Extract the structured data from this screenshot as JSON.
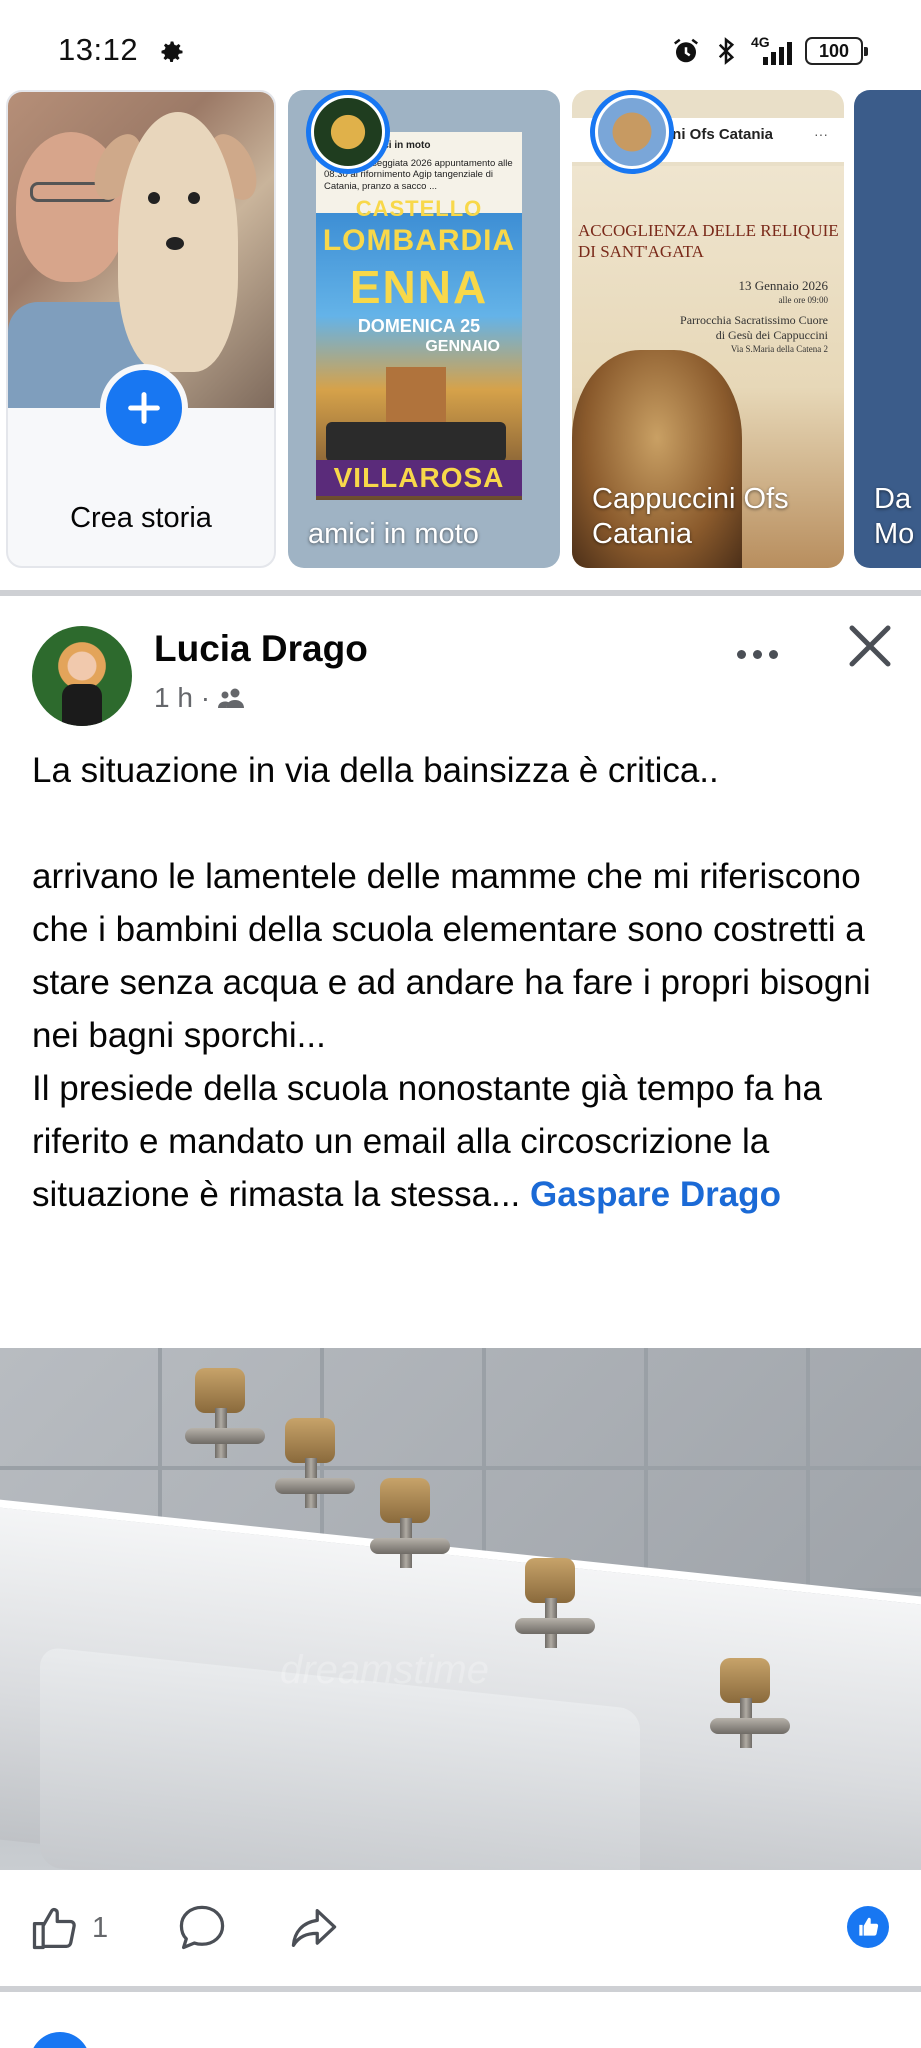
{
  "status_bar": {
    "time": "13:12",
    "network": "4G",
    "battery": "100",
    "icons": [
      "gear-icon",
      "alarm-icon",
      "bluetooth-icon",
      "signal-icon",
      "battery-icon"
    ]
  },
  "stories": {
    "create": {
      "label": "Crea storia"
    },
    "items": [
      {
        "label": "amici in moto",
        "poster_header_title": "amici in moto",
        "poster_header_text": "1°moto passeggiata 2026 appuntamento alle 08.30 al rifornimento Agip tangenziale di Catania, pranzo a sacco ...",
        "poster_line1": "CASTELLO",
        "poster_line2": "LOMBARDIA",
        "poster_line3": "ENNA",
        "poster_line4": "DOMENICA 25",
        "poster_line5": "GENNAIO",
        "poster_footer": "VILLAROSA"
      },
      {
        "label": "Cappuccini Ofs Catania",
        "header_name": "ini Ofs Catania",
        "poster_title": "ACCOGLIENZA DELLE RELIQUIE DI SANT'AGATA",
        "poster_date": "13 Gennaio 2026",
        "poster_time": "alle ore 09:00",
        "poster_place": "Parrocchia Sacratissimo Cuore di Gesù dei Cappuccini",
        "poster_address": "Via S.Maria della Catena 2"
      },
      {
        "label": "Da Mo"
      }
    ]
  },
  "post": {
    "author": "Lucia Drago",
    "time": "1 h ·",
    "audience_icon": "friends-icon",
    "text_line1": "La situazione in via della bainsizza è critica..",
    "text_para2": "arrivano le lamentele delle mamme che mi riferiscono che i bambini della scuola elementare sono costretti a stare senza acqua e ad andare ha fare i propri bisogni nei bagni sporchi...",
    "text_para3": "Il presiede della scuola nonostante già tempo fa ha riferito e mandato un email alla circoscrizione la situazione è rimasta la stessa...",
    "mention": "Gaspare Drago",
    "photo_watermark": "dreamstime",
    "like_count": "1"
  },
  "colors": {
    "accent": "#1877f2",
    "mention": "#1b6ad6",
    "meta_text": "#65676b"
  }
}
